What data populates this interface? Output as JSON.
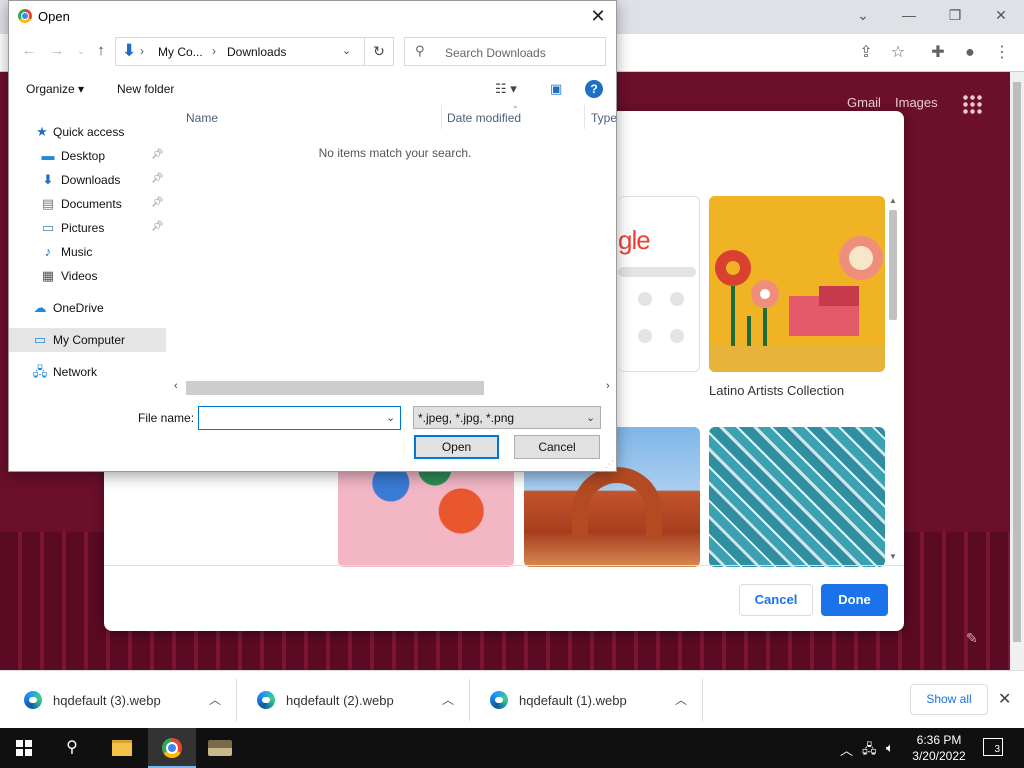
{
  "chrome": {
    "controls": {
      "chevron": "⌄",
      "minimize": "—",
      "restore": "❐",
      "close": "✕"
    },
    "toolbar_icons": [
      "share-icon",
      "star-icon",
      "puzzle-icon",
      "profile-icon",
      "menu-icon"
    ]
  },
  "newtab": {
    "gmail_label": "Gmail",
    "images_label": "Images"
  },
  "customize_modal": {
    "google_tile_text": "gle",
    "latino_caption": "Latino Artists Collection",
    "cancel_label": "Cancel",
    "done_label": "Done"
  },
  "dialog": {
    "title": "Open",
    "address": {
      "crumbs": [
        "My Co...",
        "Downloads"
      ]
    },
    "search_placeholder": "Search Downloads",
    "commands": {
      "organize": "Organize ▾",
      "new_folder": "New folder"
    },
    "nav": [
      {
        "label": "Quick access",
        "icon": "star-icon",
        "pinned": false
      },
      {
        "label": "Desktop",
        "icon": "desktop-icon",
        "pinned": true
      },
      {
        "label": "Downloads",
        "icon": "downloads-icon",
        "pinned": true
      },
      {
        "label": "Documents",
        "icon": "documents-icon",
        "pinned": true
      },
      {
        "label": "Pictures",
        "icon": "pictures-icon",
        "pinned": true
      },
      {
        "label": "Music",
        "icon": "music-icon",
        "pinned": false
      },
      {
        "label": "Videos",
        "icon": "videos-icon",
        "pinned": false
      },
      {
        "label": "OneDrive",
        "icon": "onedrive-icon",
        "pinned": false
      },
      {
        "label": "My Computer",
        "icon": "computer-icon",
        "pinned": false,
        "selected": true
      },
      {
        "label": "Network",
        "icon": "network-icon",
        "pinned": false
      }
    ],
    "columns": [
      "Name",
      "Date modified",
      "Type"
    ],
    "empty_message": "No items match your search.",
    "file_name_label": "File name:",
    "file_name_value": "",
    "file_type": "*.jpeg, *.jpg, *.png",
    "open_label": "Open",
    "cancel_label": "Cancel"
  },
  "downloads": {
    "items": [
      "hqdefault (3).webp",
      "hqdefault (2).webp",
      "hqdefault (1).webp"
    ],
    "show_all": "Show all"
  },
  "taskbar": {
    "time": "6:36 PM",
    "date": "3/20/2022",
    "notification_count": "3"
  }
}
